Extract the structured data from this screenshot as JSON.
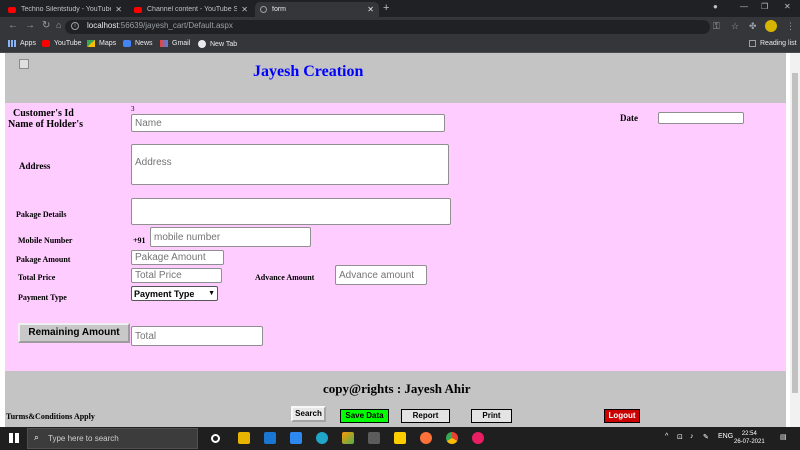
{
  "browser": {
    "tabs": [
      {
        "label": "Techno Silentstudy - YouTube",
        "favicon": "youtube-icon"
      },
      {
        "label": "Channel content - YouTube Studi",
        "favicon": "youtube-icon"
      },
      {
        "label": "form",
        "favicon": "globe-icon"
      }
    ],
    "url_host": "localhost",
    "url_path": ":56639/jayesh_cart/Default.aspx",
    "bookmarks": [
      "Apps",
      "YouTube",
      "Maps",
      "News",
      "Gmail",
      "New Tab"
    ],
    "reading_list": "Reading list"
  },
  "page": {
    "site_title": "Jayesh Creation",
    "customer_id_label": "Customer's Id",
    "customer_id_value": "3",
    "holder_label": "Name of Holder's",
    "holder_placeholder": "Name",
    "date_label": "Date",
    "address_label": "Address",
    "address_placeholder": "Address",
    "package_details_label": "Pakage Details",
    "mobile_label": "Mobile Number",
    "mobile_prefix": "+91",
    "mobile_placeholder": "mobile number",
    "package_amount_label": "Pakage Amount",
    "package_amount_placeholder": "Pakage Amount",
    "total_price_label": "Total Price",
    "total_price_placeholder": "Total Price",
    "advance_label": "Advance Amount",
    "advance_placeholder": "Advance amount",
    "payment_type_label": "Payment Type",
    "payment_type_selected": "Payment Type",
    "remaining_button": "Remaining Amount",
    "total_placeholder": "Total",
    "copyright": "copy@rights : Jayesh Ahir",
    "terms": "Turms&Conditions Apply",
    "buttons": {
      "search": "Search",
      "save": "Save Data",
      "report": "Report",
      "print": "Print",
      "logout": "Logout"
    }
  },
  "taskbar": {
    "search_placeholder": "Type here to search",
    "lang": "ENG",
    "time": "22:54",
    "date": "26-07-2021"
  },
  "colors": {
    "form_bg": "#ffccff",
    "header_bg": "#c4c4c4",
    "title_color": "#0000ff",
    "save_bg": "#00ff00",
    "logout_bg": "#cc0000"
  }
}
